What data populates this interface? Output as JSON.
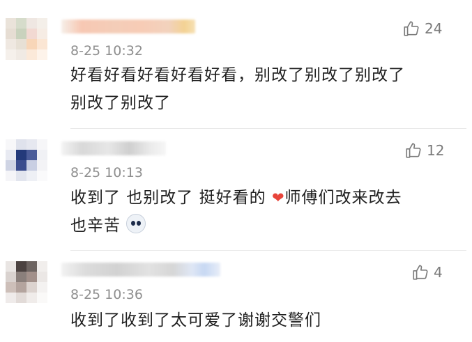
{
  "comments": [
    {
      "time": "8-25 10:32",
      "text_line1": "好看好看好看好看好看，别改了别改了别改了",
      "text_line2": "别改了别改了",
      "likes": "24"
    },
    {
      "time": "8-25 10:13",
      "text_line1_a": "收到了 也别改了 挺好看的 ",
      "heart": "❤",
      "text_line1_b": "师傅们改来改去",
      "text_line2": "也辛苦 ",
      "likes": "12"
    },
    {
      "time": "8-25 10:36",
      "text_line1": "收到了收到了太可爱了谢谢交警们",
      "likes": "4"
    }
  ],
  "colors": {
    "text": "#1f1f1f",
    "meta": "#8f8f8f",
    "heart": "#e8443a",
    "divider": "#e9e9e9"
  },
  "icons": {
    "like": "thumbs-up-icon",
    "emoji": "dog-face-emoji-icon"
  }
}
